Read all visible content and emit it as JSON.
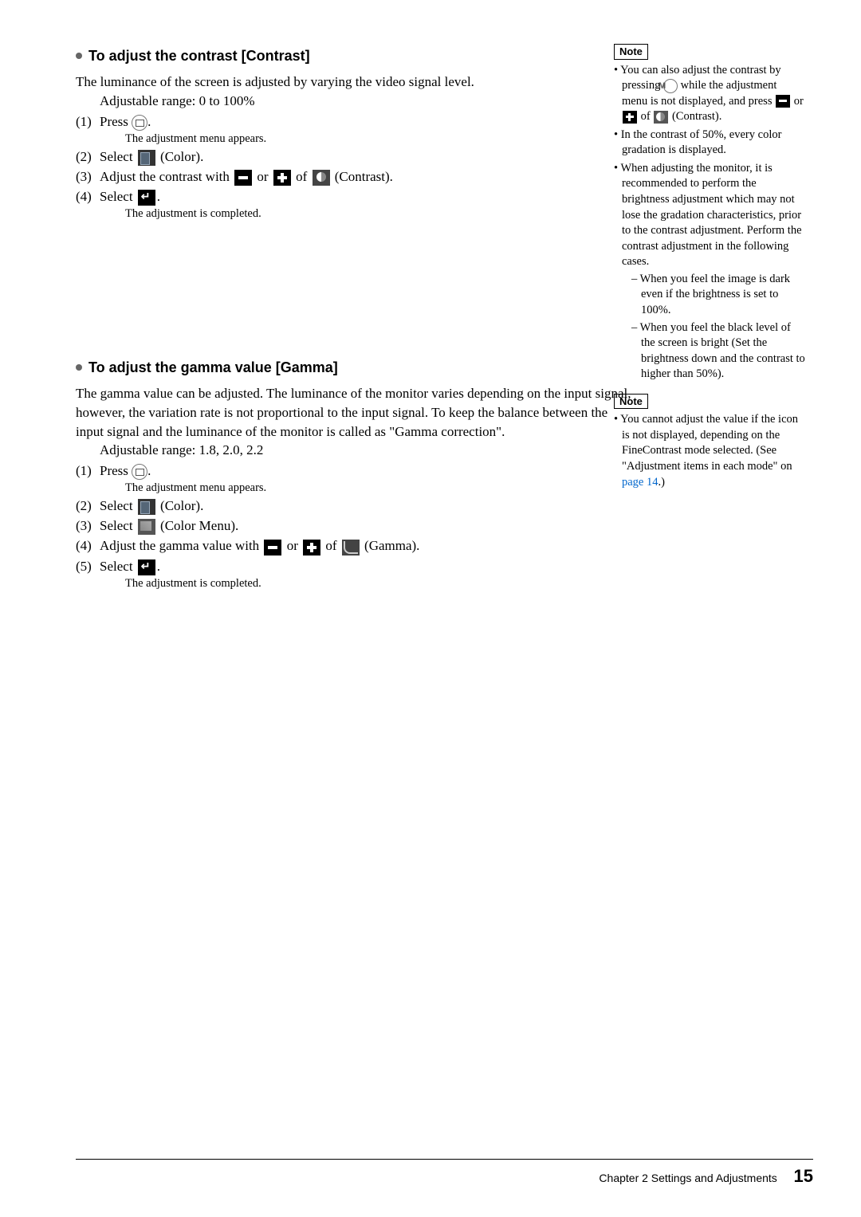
{
  "section1": {
    "heading": "To adjust the contrast [Contrast]",
    "intro": "The luminance of the screen is adjusted by varying the video signal level.",
    "range": "Adjustable range: 0 to 100%",
    "step1_num": "(1)",
    "step1_a": "Press ",
    "step1_b": ".",
    "step1_sub": "The adjustment menu appears.",
    "step2_num": "(2)",
    "step2_a": "Select ",
    "step2_b": " (Color).",
    "step3_num": "(3)",
    "step3_a": "Adjust the contrast with ",
    "step3_or": " or ",
    "step3_of": " of ",
    "step3_b": " (Contrast).",
    "step4_num": "(4)",
    "step4_a": "Select ",
    "step4_b": ".",
    "step4_sub": "The adjustment is completed."
  },
  "section2": {
    "heading": "To adjust the gamma value [Gamma]",
    "intro": "The gamma value can be adjusted. The luminance of the monitor varies depending on the input signal, however, the variation rate is not proportional to the input signal. To keep the balance between the input signal and the luminance of the monitor is called as \"Gamma correction\".",
    "range": "Adjustable range: 1.8, 2.0, 2.2",
    "step1_num": "(1)",
    "step1_a": "Press ",
    "step1_b": ".",
    "step1_sub": "The adjustment menu appears.",
    "step2_num": "(2)",
    "step2_a": "Select ",
    "step2_b": " (Color).",
    "step3_num": "(3)",
    "step3_a": "Select ",
    "step3_b": " (Color Menu).",
    "step4_num": "(4)",
    "step4_a": "Adjust the gamma value with ",
    "step4_or": " or ",
    "step4_of": " of ",
    "step4_b": " (Gamma).",
    "step5_num": "(5)",
    "step5_a": "Select ",
    "step5_b": ".",
    "step5_sub": "The adjustment is completed."
  },
  "note1": {
    "label": "Note",
    "li1a": "You can also adjust the contrast by pressing ",
    "li1b": " while the adjustment menu is not displayed, and press ",
    "li1c": " or ",
    "li1d": " of ",
    "li1e": " (Contrast).",
    "li2": "In the contrast of 50%, every color gradation is displayed.",
    "li3": "When adjusting the monitor, it is recommended to perform the brightness adjustment which may not lose the gradation characteristics, prior to the contrast adjustment. Perform the contrast adjustment in the following cases.",
    "li3a": "When you feel the image is dark even if the brightness is set to 100%.",
    "li3b": "When you feel the black level of the screen is bright (Set the brightness down and the contrast to higher than 50%)."
  },
  "note2": {
    "label": "Note",
    "li1a": "You cannot adjust the value if the icon is not displayed, depending on the FineContrast mode selected. (See \"Adjustment items in each mode\" on ",
    "li1link": "page 14",
    "li1b": ".)"
  },
  "footer": {
    "chapter": "Chapter 2  Settings and Adjustments",
    "page": "15"
  }
}
